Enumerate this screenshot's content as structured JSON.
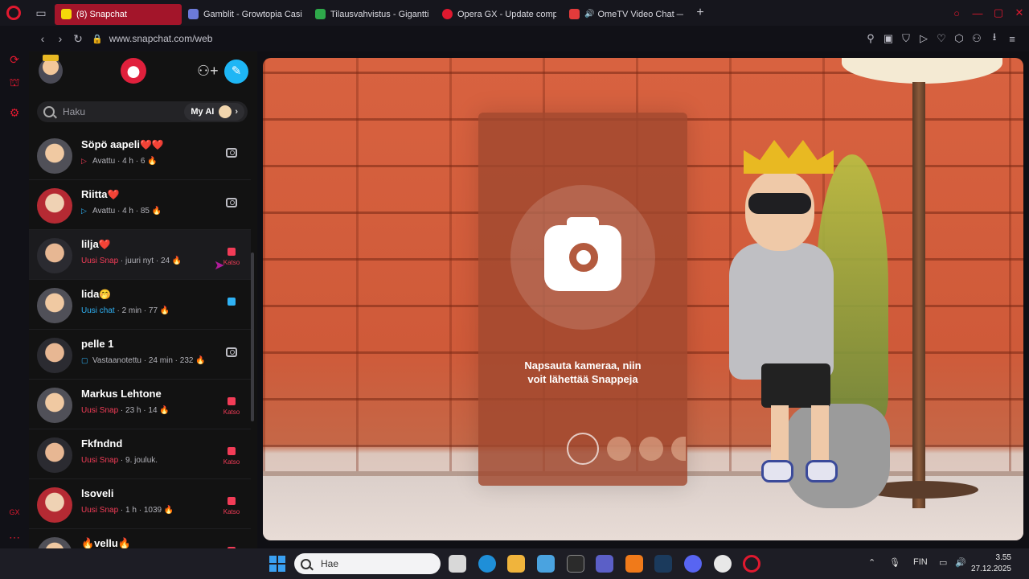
{
  "browser": {
    "tabs": [
      {
        "title": "(8) Snapchat",
        "active": true,
        "color": "#f5d90a"
      },
      {
        "title": "Gamblit - Growtopia Casin",
        "active": false,
        "color": "#6c7ad8"
      },
      {
        "title": "Tilausvahvistus - Gigantti",
        "active": false,
        "color": "#2ea84a"
      },
      {
        "title": "Opera GX - Update compl",
        "active": false,
        "color": "#e0192f"
      },
      {
        "title": "OmeTV Video Chat —",
        "active": false,
        "color": "#e33b3b"
      }
    ],
    "url": "www.snapchat.com/web"
  },
  "snapchat": {
    "search_placeholder": "Haku",
    "my_ai_label": "My AI",
    "chats": [
      {
        "name": "Söpö aapeli",
        "hearts": "❤️❤️",
        "status": "Avattu",
        "status_type": "opened",
        "time": "4 h",
        "streak": "6",
        "action": "camera"
      },
      {
        "name": "Riitta",
        "hearts": "❤️",
        "status": "Avattu",
        "status_type": "opened-blue",
        "time": "4 h",
        "streak": "85",
        "action": "camera"
      },
      {
        "name": "lilja",
        "hearts": "❤️",
        "status": "Uusi Snap",
        "status_type": "new-snap",
        "time": "juuri nyt",
        "streak": "24",
        "action": "watch"
      },
      {
        "name": "lida",
        "hearts": "🤭",
        "status": "Uusi chat",
        "status_type": "new-chat",
        "time": "2 min",
        "streak": "77",
        "action": "chat"
      },
      {
        "name": "pelle 1",
        "hearts": "",
        "status": "Vastaanotettu",
        "status_type": "received",
        "time": "24 min",
        "streak": "232",
        "action": "camera"
      },
      {
        "name": "Markus Lehtone",
        "hearts": "",
        "status": "Uusi Snap",
        "status_type": "new-snap",
        "time": "23 h",
        "streak": "14",
        "action": "watch"
      },
      {
        "name": "Fkfndnd",
        "hearts": "",
        "status": "Uusi Snap",
        "status_type": "new-snap",
        "time": "9. jouluk.",
        "streak": "",
        "action": "watch"
      },
      {
        "name": "lsoveli",
        "hearts": "",
        "status": "Uusi Snap",
        "status_type": "new-snap",
        "time": "1 h",
        "streak": "1039",
        "action": "watch"
      },
      {
        "name": "🔥vellu🔥",
        "hearts": "",
        "status": "",
        "status_type": "new-snap",
        "time": "",
        "streak": "",
        "action": "watch"
      }
    ],
    "watch_label": "Katso",
    "camera_hint": "Napsauta kameraa, niin voit lähettää Snappeja"
  },
  "taskbar": {
    "search_placeholder": "Hae",
    "language": "FIN",
    "time": "3.55",
    "date": "27.12.2025"
  },
  "colors": {
    "accent_red": "#f23c57",
    "accent_blue": "#2fb2f5",
    "opera_red": "#e0192f"
  }
}
